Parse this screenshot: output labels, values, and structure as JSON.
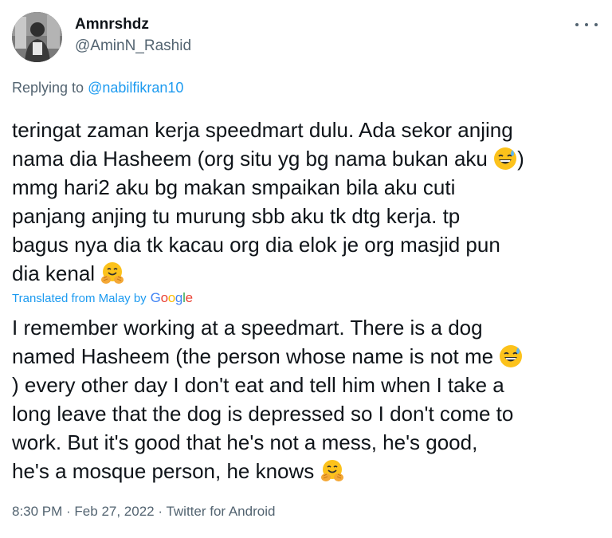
{
  "author": {
    "display_name": "Amnrshdz",
    "handle": "@AminN_Rashid"
  },
  "reply": {
    "prefix": "Replying to ",
    "mention": "@nabilfikran10"
  },
  "original_text": {
    "lang": "Malay",
    "lines": [
      "teringat zaman kerja speedmart dulu. Ada sekor anjing",
      "nama dia Hasheem (org situ yg bg nama bukan aku",
      ")",
      "mmg hari2 aku bg makan smpaikan bila aku cuti",
      "panjang anjing tu murung sbb aku tk dtg kerja. tp",
      "bagus nya dia tk kacau org dia elok je org masjid pun",
      "dia kenal"
    ]
  },
  "translation": {
    "label": "Translated from Malay by",
    "provider": "Google",
    "lines": [
      "I remember working at a speedmart. There is a dog",
      "named Hasheem (the person whose name is not me",
      ") every other day I don't eat and tell him when I take a",
      "long leave that the dog is depressed so I don't come to",
      "work. But it's good that he's not a mess, he's good,",
      "he's a mosque person, he knows"
    ]
  },
  "meta": {
    "time": "8:30 PM",
    "separator": " · ",
    "date": "Feb 27, 2022",
    "source": "Twitter for Android"
  },
  "icons": {
    "more": "more-options-icon",
    "emoji_sweat": "grinning-face-with-sweat-icon",
    "emoji_hug": "hugging-face-icon"
  },
  "colors": {
    "text": "#0f1419",
    "secondary": "#536471",
    "accent": "#1d9bf0"
  }
}
